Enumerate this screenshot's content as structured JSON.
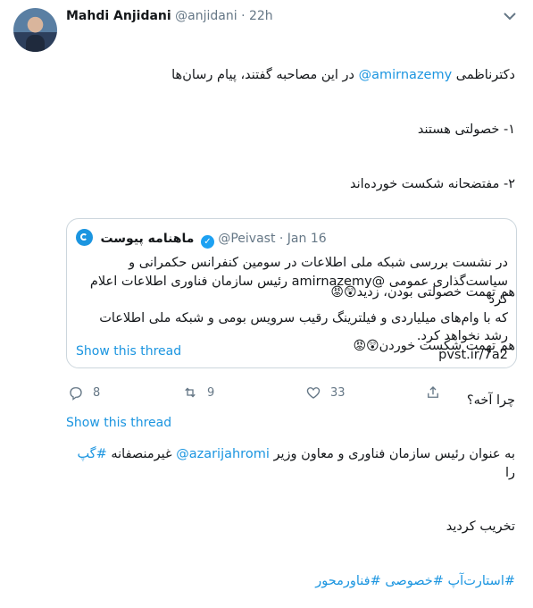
{
  "tweet": {
    "author_name": "Mahdi Anjidani",
    "author_handle": "@anjidani",
    "separator": "·",
    "time": "22h",
    "lines": [
      {
        "before": "دکترناظمی ",
        "mention": "@amirnazemy",
        "after": " در این مصاحبه گفتند، پیام رسان‌ها"
      },
      {
        "text": "۱- خصولتی هستند"
      },
      {
        "text": "۲- مفتضحانه شکست خورده‌اند"
      },
      {
        "text": ""
      },
      {
        "text": "هم تهمت خصولتی بودن، زدید",
        "emoji": "😲😡"
      },
      {
        "text": "هم تهمت شکست خوردن",
        "emoji": "😲😡"
      },
      {
        "text": "چرا آخه؟"
      },
      {
        "before": "به عنوان رئیس سازمان فناوری و معاون وزیر ",
        "mention": "@azarijahromi",
        "after": " غیرمنصفانه ",
        "hashtag": "#گپ",
        "tail": " را"
      },
      {
        "text": "تخریب کردید"
      },
      {
        "hashtags": "#استارت‌آپ #خصوصی #فناورمحور"
      }
    ]
  },
  "quoted": {
    "name": "ماهنامه پیوست",
    "handle": "@Peivast",
    "separator": "·",
    "date": "Jan 16",
    "lines": [
      "در نشست بررسی شبکه ملی اطلاعات در سومین کنفرانس حکمرانی و",
      "سیاست‌گذاری عمومی @amirnazemy رئیس سازمان فناوری اطلاعات اعلام کرد",
      "که با وام‌های میلیاردی و فیلترینگ رقیب سرویس بومی و شبکه ملی اطلاعات",
      "رشد نخواهد کرد.",
      "pvst.ir/7a2"
    ],
    "show_thread": "Show this thread"
  },
  "actions": {
    "reply_count": "8",
    "retweet_count": "9",
    "like_count": "33"
  },
  "show_thread": "Show this thread",
  "icons": {
    "more": "chevron-down-icon",
    "reply": "reply-icon",
    "retweet": "retweet-icon",
    "like": "heart-icon",
    "share": "share-icon",
    "verified": "verified-badge-icon"
  },
  "colors": {
    "link": "#1b95e0",
    "text": "#14171a",
    "muted": "#657786",
    "border": "#ccd6dd"
  }
}
